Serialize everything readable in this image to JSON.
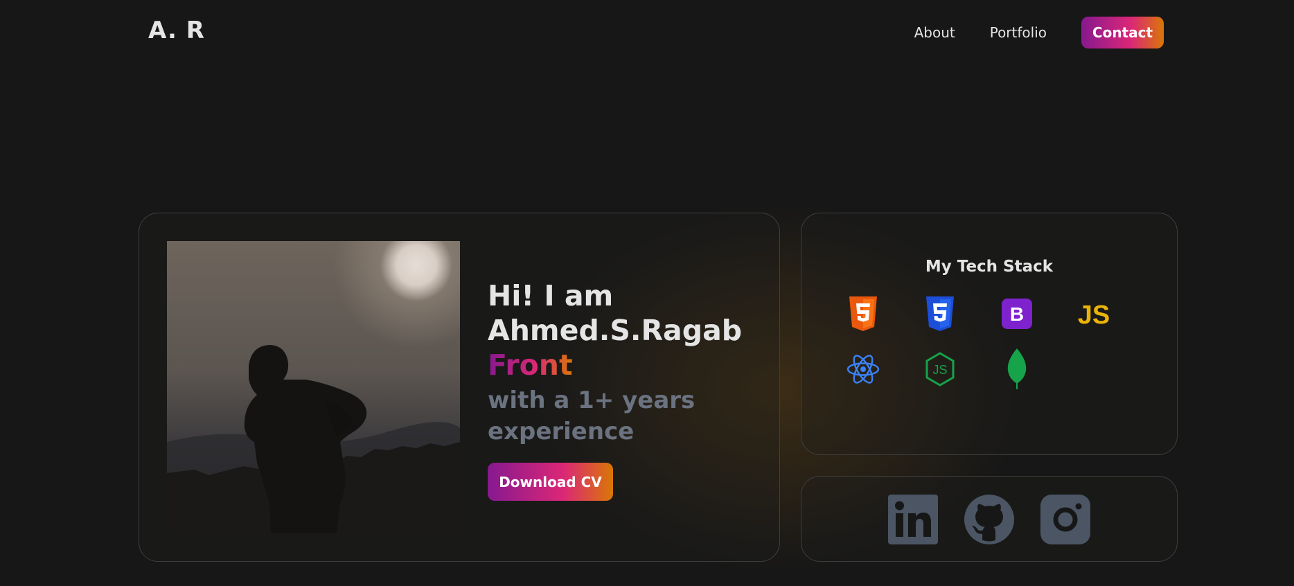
{
  "header": {
    "logo": "A. R",
    "nav": [
      {
        "label": "About"
      },
      {
        "label": "Portfolio"
      }
    ],
    "contact_label": "Contact"
  },
  "hero": {
    "greeting_line1": "Hi! I am",
    "greeting_line2": "Ahmed.S.Ragab",
    "role": "Front",
    "experience_line1": "with a 1+ years",
    "experience_line2": "experience",
    "download_label": "Download CV"
  },
  "tech_stack": {
    "title": "My Tech Stack",
    "icons": [
      "html5-icon",
      "css3-icon",
      "bootstrap-icon",
      "javascript-icon",
      "react-icon",
      "nodejs-icon",
      "mongodb-icon"
    ]
  },
  "social": {
    "icons": [
      "linkedin-icon",
      "github-icon",
      "instagram-icon"
    ]
  },
  "colors": {
    "background": "#171717",
    "accent_start": "#86198f",
    "accent_mid": "#db2777",
    "accent_end": "#d97706",
    "muted_text": "#6b7280",
    "social_icon": "#4b5563"
  }
}
